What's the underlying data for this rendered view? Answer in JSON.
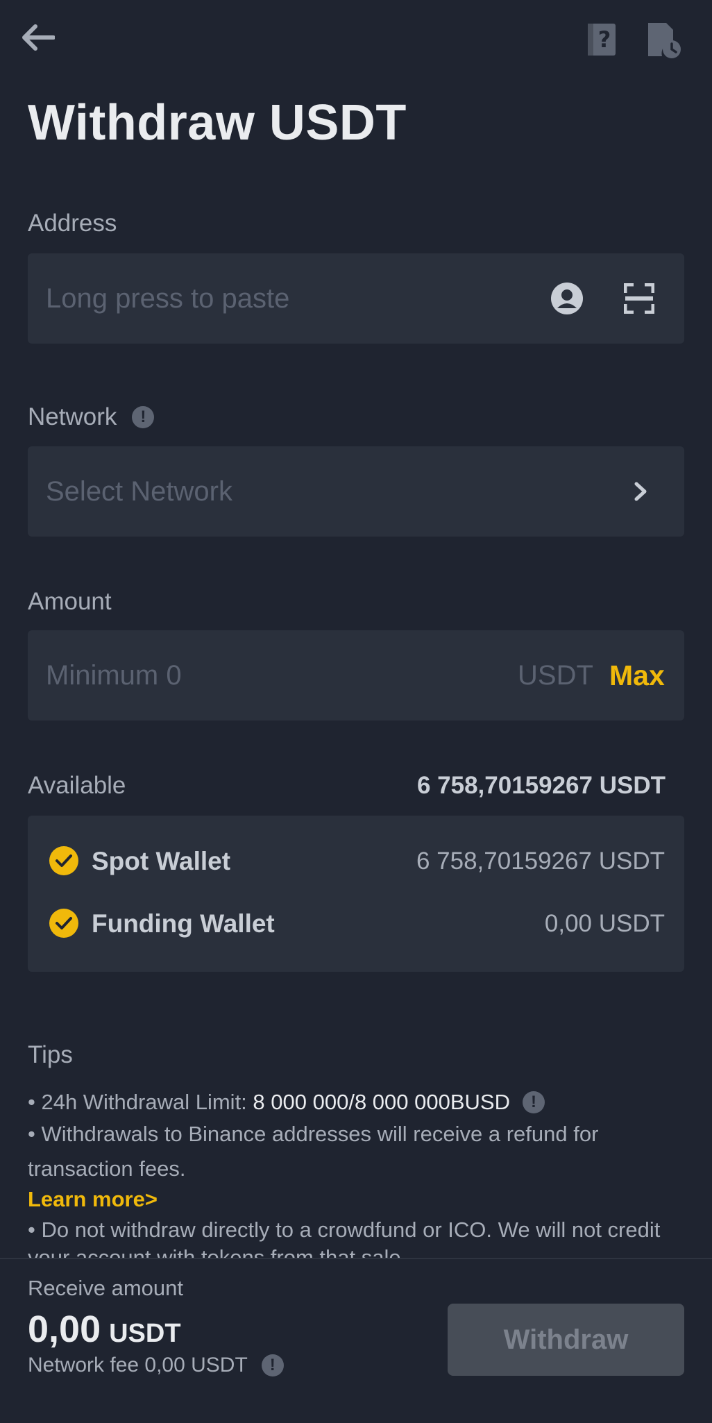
{
  "header": {
    "title": "Withdraw USDT",
    "back_icon": "arrow-left-icon",
    "faq_icon": "question-book-icon",
    "history_icon": "document-clock-icon"
  },
  "address": {
    "label": "Address",
    "placeholder": "Long press to paste",
    "contact_icon": "user-circle-icon",
    "scan_icon": "qr-scan-icon"
  },
  "network": {
    "label": "Network",
    "placeholder": "Select Network",
    "info_icon": "exclamation-circle-icon",
    "chevron_icon": "chevron-right-icon"
  },
  "amount": {
    "label": "Amount",
    "placeholder": "Minimum 0",
    "unit": "USDT",
    "max_label": "Max"
  },
  "available": {
    "label": "Available",
    "value": "6 758,70159267 USDT",
    "wallets": [
      {
        "name": "Spot Wallet",
        "value": "6 758,70159267 USDT",
        "checked": true
      },
      {
        "name": "Funding Wallet",
        "value": "0,00 USDT",
        "checked": true
      }
    ]
  },
  "tips": {
    "title": "Tips",
    "limit_prefix": "• 24h Withdrawal Limit: ",
    "limit_value": "8 000 000/8 000 000BUSD",
    "refund_line1": "• Withdrawals to Binance addresses will receive a refund for",
    "refund_line2": "transaction fees.",
    "learn_more": "Learn more>",
    "warning_line1": "• Do not withdraw directly to a crowdfund or ICO. We will not credit",
    "warning_line2": "your account with tokens from that sale."
  },
  "footer": {
    "receive_label": "Receive amount",
    "receive_value": "0,00",
    "receive_unit": "USDT",
    "fee_text": "Network fee 0,00 USDT",
    "withdraw_label": "Withdraw"
  },
  "colors": {
    "background": "#1f2430",
    "field": "#2a303c",
    "accent": "#f0b90b",
    "muted": "#a7adb8",
    "placeholder": "#5b6271",
    "button_disabled": "#474d57"
  }
}
